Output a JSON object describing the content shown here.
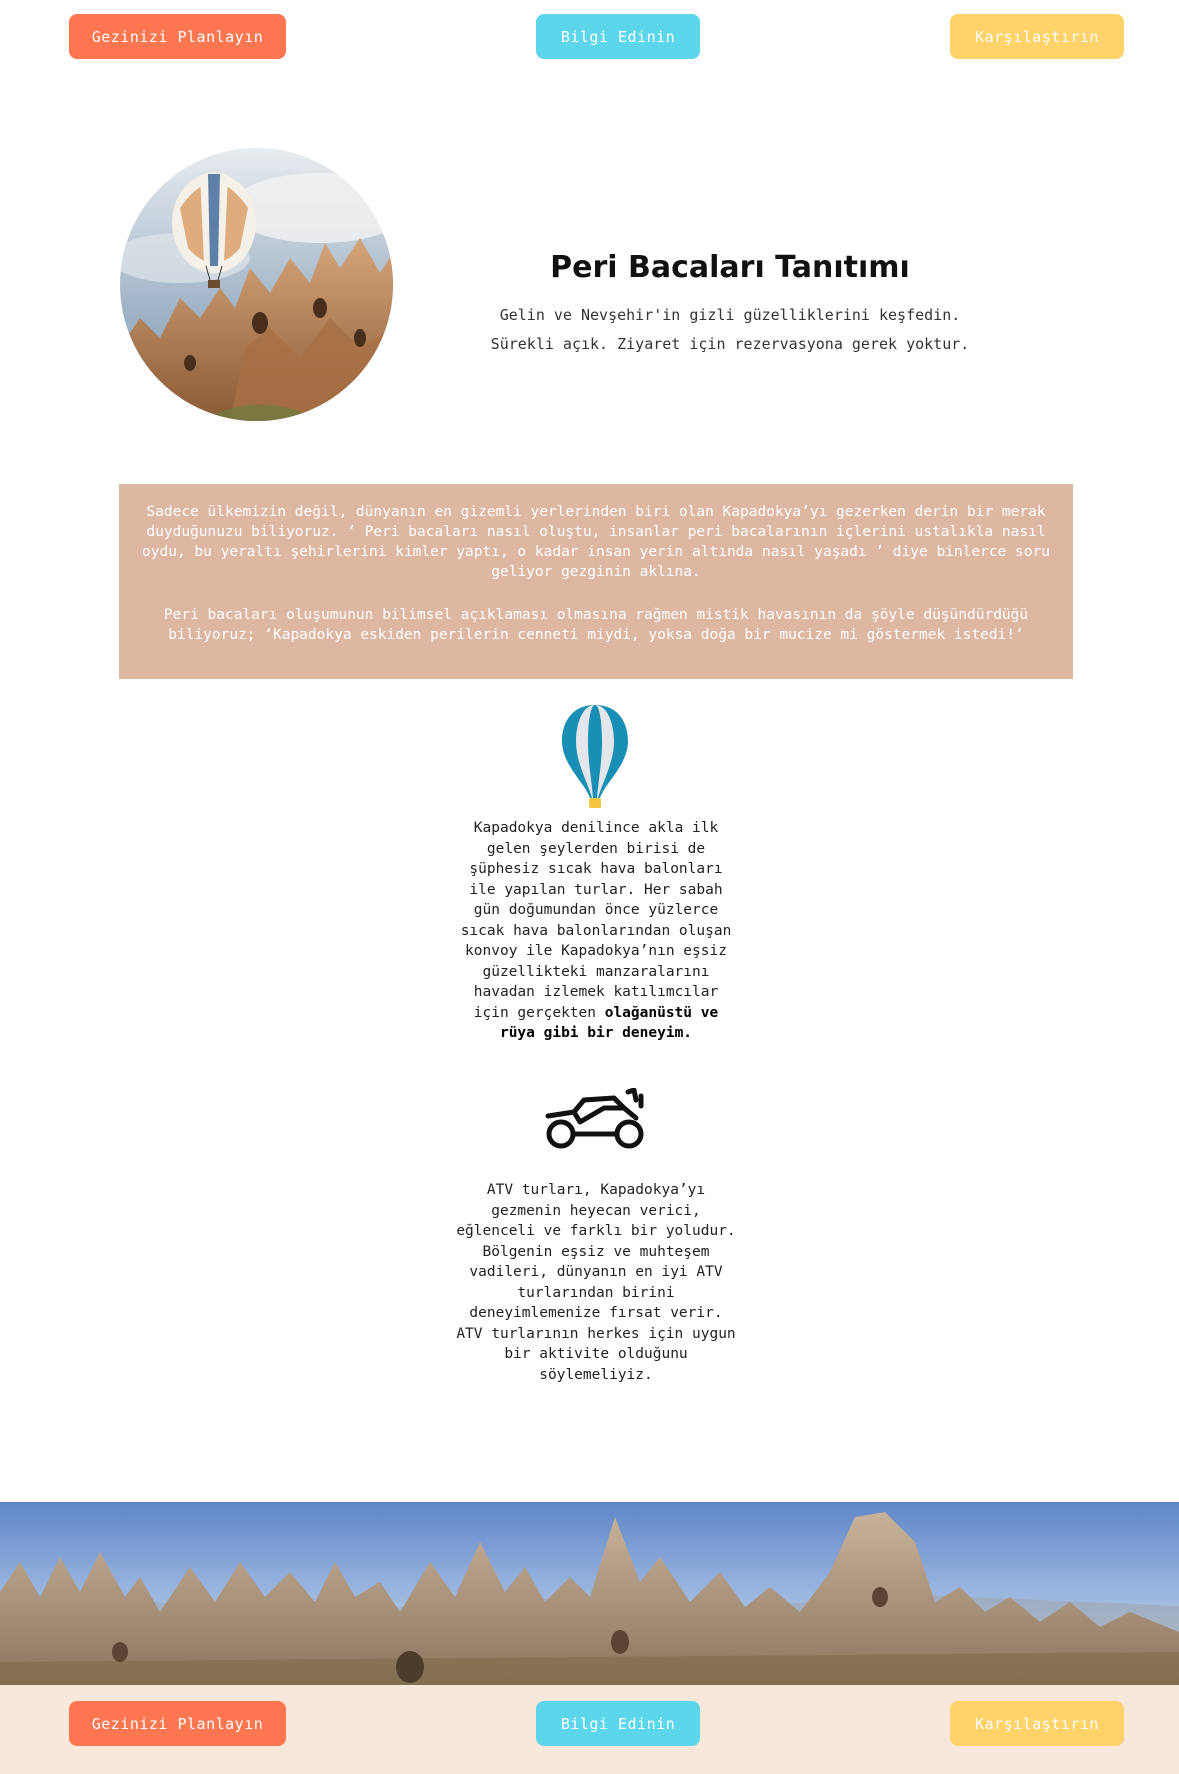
{
  "nav": {
    "plan_label": "Gezinizi Planlayın",
    "info_label": "Bilgi Edinin",
    "compare_label": "Karşılaştırın"
  },
  "hero": {
    "title": "Peri Bacaları Tanıtımı",
    "line1": "Gelin ve Nevşehir'in gizli güzelliklerini keşfedin.",
    "line2": "Sürekli açık. Ziyaret için rezervasyona gerek yoktur."
  },
  "story": {
    "paragraph1": "Sadece ülkemizin değil, dünyanın en gizemli yerlerinden biri olan Kapadokya’yı gezerken derin bir merak duyduğunuzu biliyoruz. ‘ Peri bacaları nasıl oluştu, insanlar peri bacalarının içlerini ustalıkla nasıl oydu, bu yeraltı şehirlerini kimler yaptı, o kadar insan yerin altında nasıl yaşadı ’ diye binlerce soru geliyor gezginin aklına.",
    "paragraph2": "Peri bacaları oluşumunun bilimsel açıklaması olmasına rağmen mistik havasının da şöyle düşündürdüğü biliyoruz; ‘Kapadokya eskiden perilerin cenneti miydi, yoksa doğa bir mucize mi göstermek istedi!’"
  },
  "balloon_feature": {
    "icon": "hot-air-balloon-icon",
    "text": "Kapadokya denilince akla ilk gelen şeylerden birisi de şüphesiz sıcak hava balonları ile yapılan turlar. Her sabah gün doğumundan önce yüzlerce sıcak hava balonlarından oluşan konvoy ile Kapadokya’nın eşsiz güzellikteki manzaralarını havadan izlemek katılımcılar için gerçekten",
    "bold": "olağanüstü ve rüya gibi bir deneyim."
  },
  "atv_feature": {
    "icon": "atv-icon",
    "text": "ATV turları, Kapadokya’yı gezmenin heyecan verici, eğlenceli ve farklı bir yoludur. Bölgenin eşsiz ve muhteşem vadileri, dünyanın en iyi ATV turlarından birini deneyimlemenize fırsat verir. ATV turlarının herkes için uygun bir aktivite olduğunu söylemeliyiz."
  },
  "colors": {
    "plan": "#FF7650",
    "info": "#5DD6EC",
    "compare": "#FFD26A",
    "story_bg": "#DDB7A2",
    "footer_bg": "#F8E7DB"
  }
}
